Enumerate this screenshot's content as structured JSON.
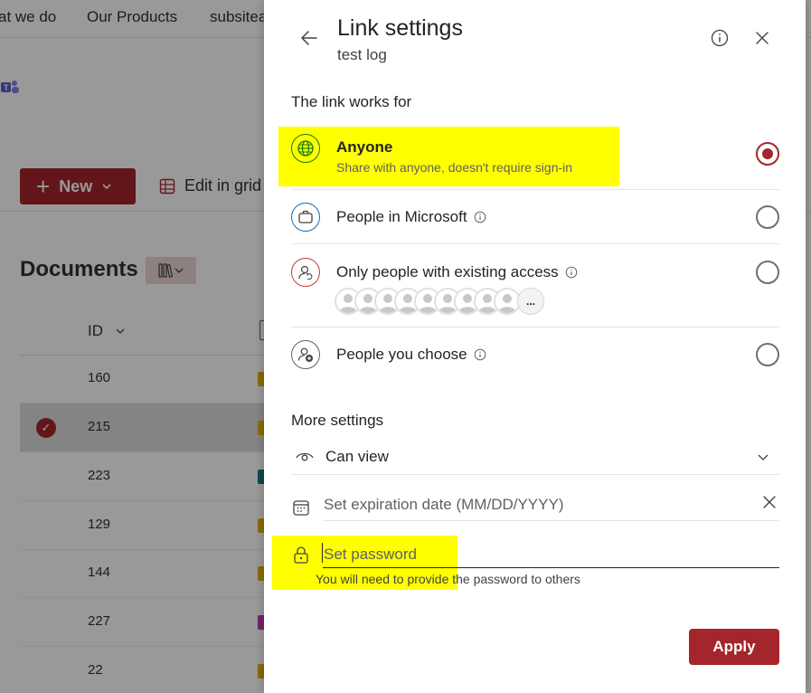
{
  "background": {
    "nav": [
      "at we do",
      "Our Products",
      "subsitea"
    ],
    "new_label": "New",
    "edit_label": "Edit in grid",
    "docs_title": "Documents",
    "id_header": "ID",
    "rows": [
      {
        "id": "160",
        "color": "#e8b500"
      },
      {
        "id": "215",
        "color": "#e8b500"
      },
      {
        "id": "223",
        "color": "#0f7c7f"
      },
      {
        "id": "129",
        "color": "#e8b500"
      },
      {
        "id": "144",
        "color": "#e8b500"
      },
      {
        "id": "227",
        "color": "#c239b3"
      },
      {
        "id": "22",
        "color": "#e8b500"
      }
    ]
  },
  "dialog": {
    "title": "Link settings",
    "subtitle": "test log",
    "section_link": "The link works for",
    "options": [
      {
        "label": "Anyone",
        "desc": "Share with anyone, doesn't require sign-in",
        "selected": true
      },
      {
        "label": "People in Microsoft",
        "selected": false
      },
      {
        "label": "Only people with existing access",
        "selected": false
      },
      {
        "label": "People you choose",
        "selected": false
      }
    ],
    "more_avatars_label": "...",
    "section_more": "More settings",
    "permission_value": "Can view",
    "expiration_placeholder": "Set expiration date (MM/DD/YYYY)",
    "password_placeholder": "Set password",
    "password_helper": "You will need to provide the password to others",
    "apply_label": "Apply"
  },
  "colors": {
    "accent": "#a4262c",
    "highlight": "#ffff00",
    "anyone_icon": "#107c10",
    "microsoft_icon": "#0f6cbd",
    "existing_icon": "#d13438"
  },
  "icons": [
    "back-arrow-icon",
    "info-icon",
    "close-icon",
    "globe-icon",
    "briefcase-icon",
    "person-refresh-icon",
    "person-add-icon",
    "eye-icon",
    "chevron-down-icon",
    "calendar-icon",
    "lock-icon"
  ]
}
